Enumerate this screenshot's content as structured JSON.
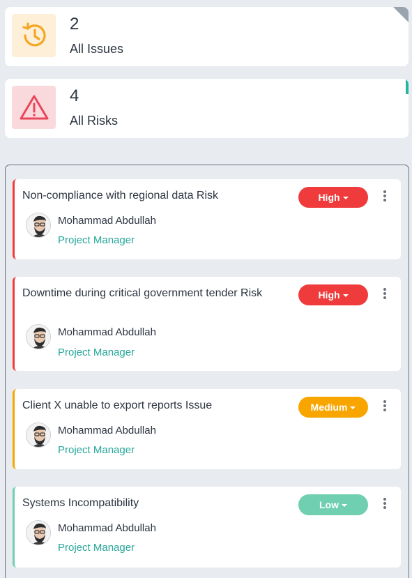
{
  "summary": {
    "issues": {
      "count": "2",
      "label": "All Issues",
      "icon": "history-clock-icon",
      "icon_color": "#f5a623",
      "bg": "#fdefd8"
    },
    "risks": {
      "count": "4",
      "label": "All Risks",
      "icon": "warning-triangle-icon",
      "icon_color": "#e8475a",
      "bg": "#fad9dd"
    }
  },
  "colors": {
    "high": "#ef3b3b",
    "medium": "#f8a500",
    "low": "#6fcfb0",
    "role": "#26a69a"
  },
  "items": [
    {
      "title": "Non-compliance with regional data Risk",
      "priority": "High",
      "person": "Mohammad Abdullah",
      "role": "Project Manager"
    },
    {
      "title": "Downtime during critical government tender Risk",
      "priority": "High",
      "person": "Mohammad Abdullah",
      "role": "Project Manager"
    },
    {
      "title": "Client X unable to export reports Issue",
      "priority": "Medium",
      "person": "Mohammad Abdullah",
      "role": "Project Manager"
    },
    {
      "title": "Systems Incompatibility",
      "priority": "Low",
      "person": "Mohammad Abdullah",
      "role": "Project Manager"
    }
  ]
}
